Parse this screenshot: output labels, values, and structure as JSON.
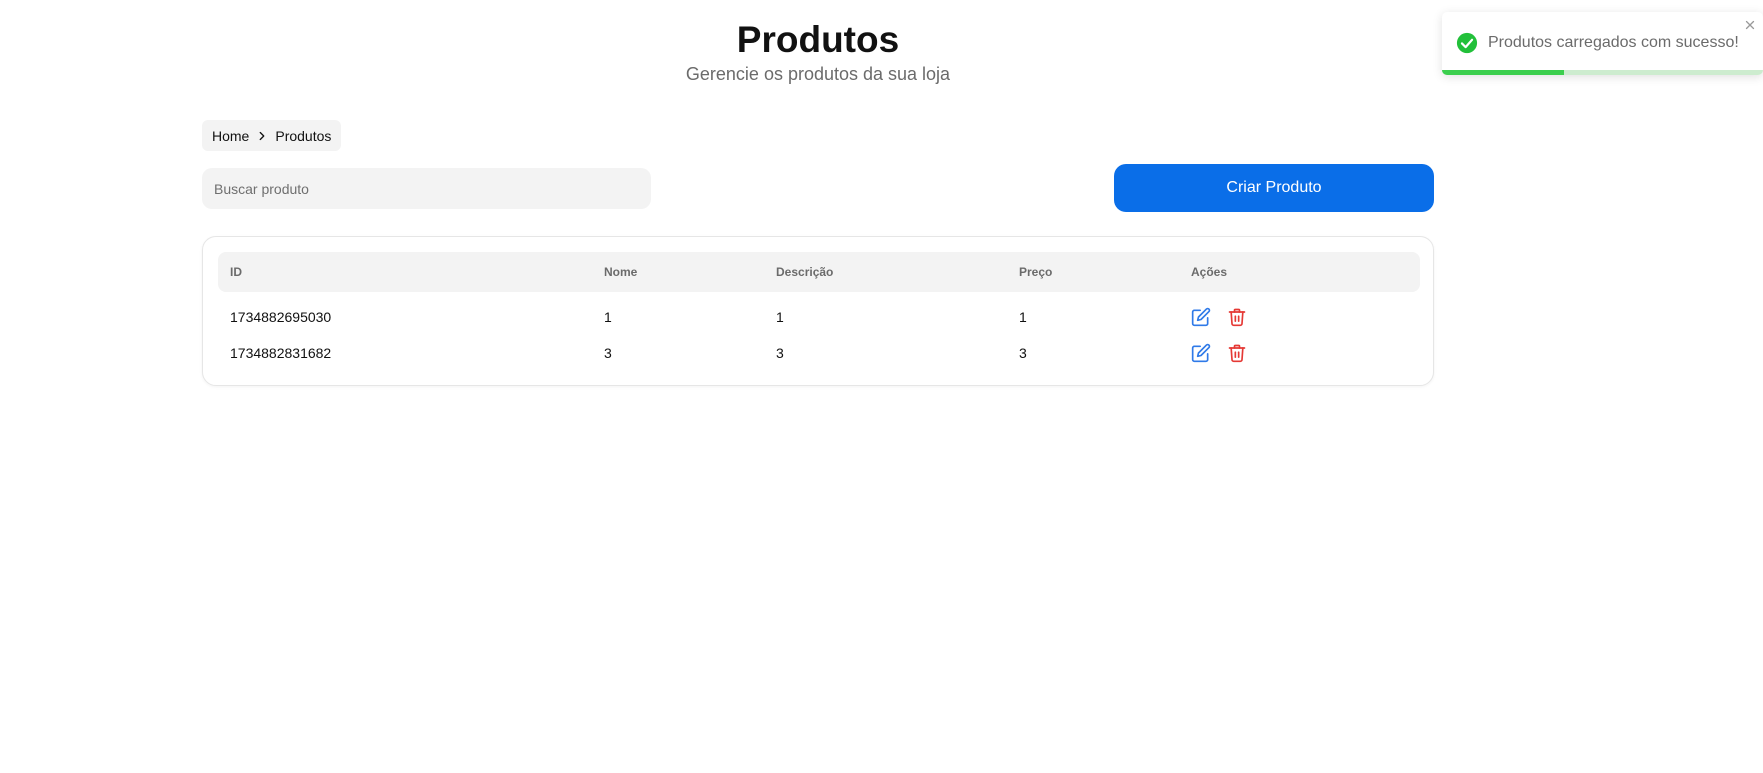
{
  "header": {
    "title": "Produtos",
    "subtitle": "Gerencie os produtos da sua loja"
  },
  "breadcrumb": {
    "items": [
      "Home",
      "Produtos"
    ]
  },
  "search": {
    "placeholder": "Buscar produto",
    "value": ""
  },
  "actions": {
    "create_label": "Criar Produto"
  },
  "table": {
    "columns": [
      "ID",
      "Nome",
      "Descrição",
      "Preço",
      "Ações"
    ],
    "rows": [
      {
        "id": "1734882695030",
        "nome": "1",
        "descricao": "1",
        "preco": "1"
      },
      {
        "id": "1734882831682",
        "nome": "3",
        "descricao": "3",
        "preco": "3"
      }
    ]
  },
  "toast": {
    "message": "Produtos carregados com sucesso!",
    "progress_fraction": 0.38,
    "icon": "check-circle-icon"
  },
  "colors": {
    "primary": "#0a6ee8",
    "edit": "#2f7ae8",
    "delete": "#e53935",
    "success": "#22c03a",
    "progress": "#3ccf4e"
  }
}
